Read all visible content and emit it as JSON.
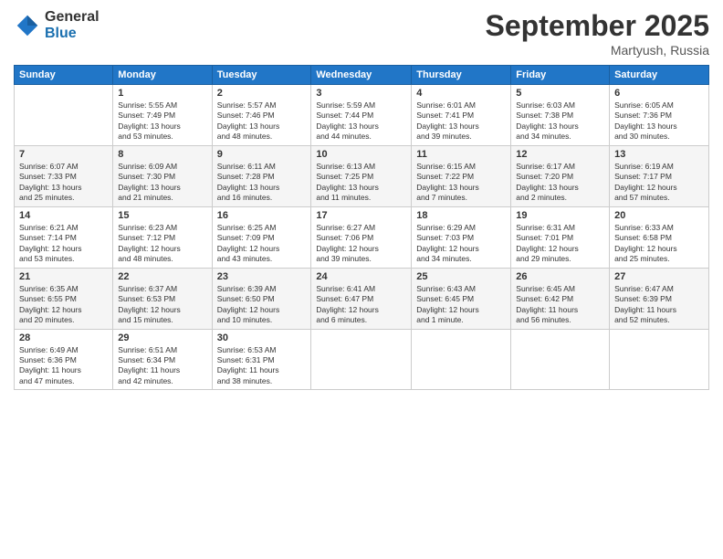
{
  "logo": {
    "general": "General",
    "blue": "Blue"
  },
  "header": {
    "month": "September 2025",
    "location": "Martyush, Russia"
  },
  "weekdays": [
    "Sunday",
    "Monday",
    "Tuesday",
    "Wednesday",
    "Thursday",
    "Friday",
    "Saturday"
  ],
  "weeks": [
    [
      {
        "day": "",
        "info": ""
      },
      {
        "day": "1",
        "info": "Sunrise: 5:55 AM\nSunset: 7:49 PM\nDaylight: 13 hours\nand 53 minutes."
      },
      {
        "day": "2",
        "info": "Sunrise: 5:57 AM\nSunset: 7:46 PM\nDaylight: 13 hours\nand 48 minutes."
      },
      {
        "day": "3",
        "info": "Sunrise: 5:59 AM\nSunset: 7:44 PM\nDaylight: 13 hours\nand 44 minutes."
      },
      {
        "day": "4",
        "info": "Sunrise: 6:01 AM\nSunset: 7:41 PM\nDaylight: 13 hours\nand 39 minutes."
      },
      {
        "day": "5",
        "info": "Sunrise: 6:03 AM\nSunset: 7:38 PM\nDaylight: 13 hours\nand 34 minutes."
      },
      {
        "day": "6",
        "info": "Sunrise: 6:05 AM\nSunset: 7:36 PM\nDaylight: 13 hours\nand 30 minutes."
      }
    ],
    [
      {
        "day": "7",
        "info": "Sunrise: 6:07 AM\nSunset: 7:33 PM\nDaylight: 13 hours\nand 25 minutes."
      },
      {
        "day": "8",
        "info": "Sunrise: 6:09 AM\nSunset: 7:30 PM\nDaylight: 13 hours\nand 21 minutes."
      },
      {
        "day": "9",
        "info": "Sunrise: 6:11 AM\nSunset: 7:28 PM\nDaylight: 13 hours\nand 16 minutes."
      },
      {
        "day": "10",
        "info": "Sunrise: 6:13 AM\nSunset: 7:25 PM\nDaylight: 13 hours\nand 11 minutes."
      },
      {
        "day": "11",
        "info": "Sunrise: 6:15 AM\nSunset: 7:22 PM\nDaylight: 13 hours\nand 7 minutes."
      },
      {
        "day": "12",
        "info": "Sunrise: 6:17 AM\nSunset: 7:20 PM\nDaylight: 13 hours\nand 2 minutes."
      },
      {
        "day": "13",
        "info": "Sunrise: 6:19 AM\nSunset: 7:17 PM\nDaylight: 12 hours\nand 57 minutes."
      }
    ],
    [
      {
        "day": "14",
        "info": "Sunrise: 6:21 AM\nSunset: 7:14 PM\nDaylight: 12 hours\nand 53 minutes."
      },
      {
        "day": "15",
        "info": "Sunrise: 6:23 AM\nSunset: 7:12 PM\nDaylight: 12 hours\nand 48 minutes."
      },
      {
        "day": "16",
        "info": "Sunrise: 6:25 AM\nSunset: 7:09 PM\nDaylight: 12 hours\nand 43 minutes."
      },
      {
        "day": "17",
        "info": "Sunrise: 6:27 AM\nSunset: 7:06 PM\nDaylight: 12 hours\nand 39 minutes."
      },
      {
        "day": "18",
        "info": "Sunrise: 6:29 AM\nSunset: 7:03 PM\nDaylight: 12 hours\nand 34 minutes."
      },
      {
        "day": "19",
        "info": "Sunrise: 6:31 AM\nSunset: 7:01 PM\nDaylight: 12 hours\nand 29 minutes."
      },
      {
        "day": "20",
        "info": "Sunrise: 6:33 AM\nSunset: 6:58 PM\nDaylight: 12 hours\nand 25 minutes."
      }
    ],
    [
      {
        "day": "21",
        "info": "Sunrise: 6:35 AM\nSunset: 6:55 PM\nDaylight: 12 hours\nand 20 minutes."
      },
      {
        "day": "22",
        "info": "Sunrise: 6:37 AM\nSunset: 6:53 PM\nDaylight: 12 hours\nand 15 minutes."
      },
      {
        "day": "23",
        "info": "Sunrise: 6:39 AM\nSunset: 6:50 PM\nDaylight: 12 hours\nand 10 minutes."
      },
      {
        "day": "24",
        "info": "Sunrise: 6:41 AM\nSunset: 6:47 PM\nDaylight: 12 hours\nand 6 minutes."
      },
      {
        "day": "25",
        "info": "Sunrise: 6:43 AM\nSunset: 6:45 PM\nDaylight: 12 hours\nand 1 minute."
      },
      {
        "day": "26",
        "info": "Sunrise: 6:45 AM\nSunset: 6:42 PM\nDaylight: 11 hours\nand 56 minutes."
      },
      {
        "day": "27",
        "info": "Sunrise: 6:47 AM\nSunset: 6:39 PM\nDaylight: 11 hours\nand 52 minutes."
      }
    ],
    [
      {
        "day": "28",
        "info": "Sunrise: 6:49 AM\nSunset: 6:36 PM\nDaylight: 11 hours\nand 47 minutes."
      },
      {
        "day": "29",
        "info": "Sunrise: 6:51 AM\nSunset: 6:34 PM\nDaylight: 11 hours\nand 42 minutes."
      },
      {
        "day": "30",
        "info": "Sunrise: 6:53 AM\nSunset: 6:31 PM\nDaylight: 11 hours\nand 38 minutes."
      },
      {
        "day": "",
        "info": ""
      },
      {
        "day": "",
        "info": ""
      },
      {
        "day": "",
        "info": ""
      },
      {
        "day": "",
        "info": ""
      }
    ]
  ]
}
